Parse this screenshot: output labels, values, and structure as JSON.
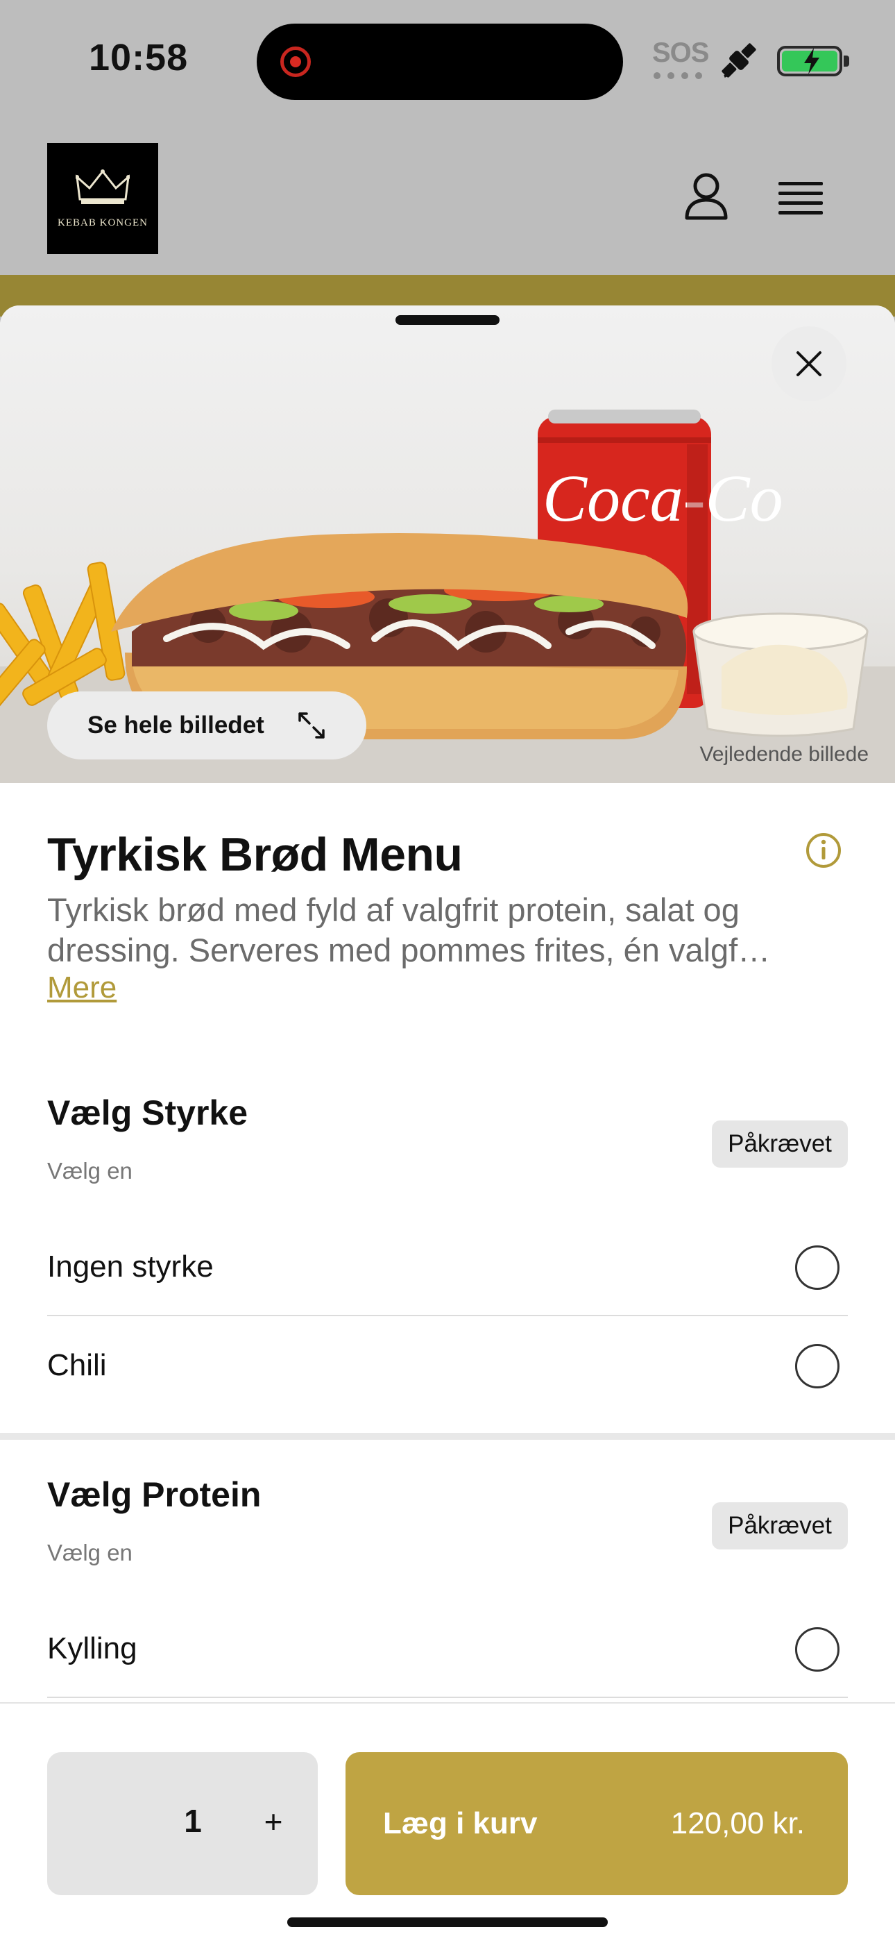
{
  "status_bar": {
    "time": "10:58",
    "sos": "SOS",
    "icons": [
      "recording-icon",
      "satellite-icon",
      "battery-charging-icon"
    ]
  },
  "header": {
    "logo_text": "KEBAB KONGEN",
    "icons": [
      "crown-icon",
      "user-icon",
      "hamburger-menu-icon"
    ]
  },
  "colors": {
    "accent_gold": "#bfa443",
    "header_bg": "#bdbdbd",
    "link_gold": "#b19a3a"
  },
  "hero": {
    "see_image_label": "Se hele billedet",
    "guide_label": "Vejledende billede"
  },
  "product": {
    "title": "Tyrkisk Brød Menu",
    "description_line1": "Tyrkisk brød med fyld af valgfrit protein, salat og",
    "description_line2": "dressing. Serveres med pommes frites, én valgf…",
    "more_label": "Mere"
  },
  "sections": [
    {
      "title": "Vælg Styrke",
      "subtitle": "Vælg en",
      "badge": "Påkrævet",
      "options": [
        {
          "label": "Ingen styrke"
        },
        {
          "label": "Chili"
        }
      ]
    },
    {
      "title": "Vælg Protein",
      "subtitle": "Vælg en",
      "badge": "Påkrævet",
      "options": [
        {
          "label": "Kylling"
        }
      ]
    }
  ],
  "cart": {
    "quantity": "1",
    "plus_label": "+",
    "add_label": "Læg i kurv",
    "price": "120,00 kr."
  }
}
